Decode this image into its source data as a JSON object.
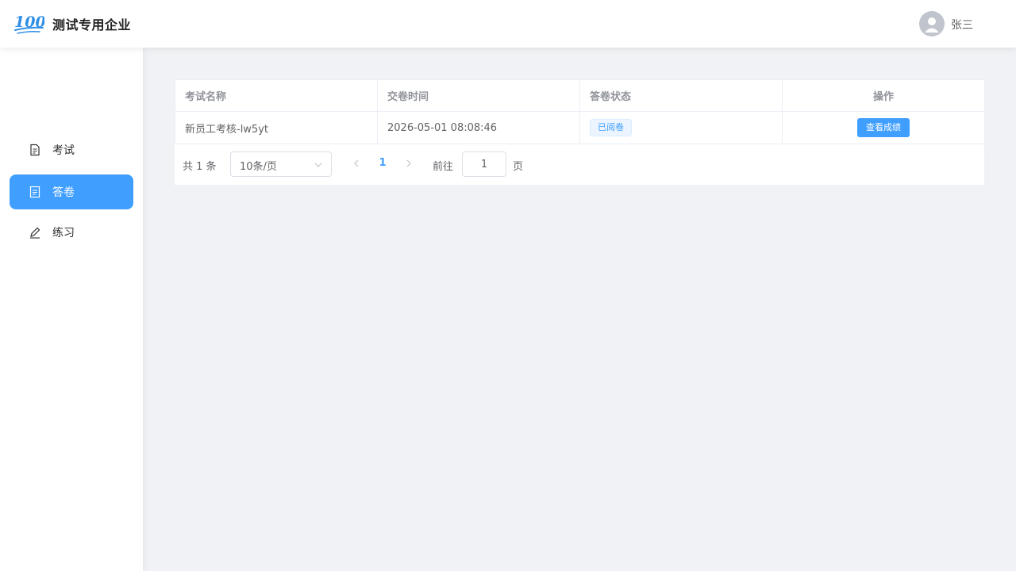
{
  "header": {
    "company_name": "测试专用企业",
    "user_name": "张三",
    "logo_icon": "logo-100-icon",
    "avatar_icon": "user-avatar-icon"
  },
  "sidebar": {
    "items": [
      {
        "label": "考试",
        "icon": "document-icon",
        "active": false
      },
      {
        "label": "答卷",
        "icon": "answer-sheet-icon",
        "active": true
      },
      {
        "label": "练习",
        "icon": "pencil-icon",
        "active": false
      }
    ]
  },
  "table": {
    "headers": [
      "考试名称",
      "交卷时间",
      "答卷状态",
      "操作"
    ],
    "rows": [
      {
        "exam_name": "新员工考核-lw5yt",
        "submit_time": "2026-05-01 08:08:46",
        "status": "已阅卷",
        "action_label": "查看成绩"
      }
    ]
  },
  "pagination": {
    "total_text": "共 1 条",
    "page_size": "10条/页",
    "current_page": "1",
    "goto_label": "前往",
    "goto_value": "1",
    "page_unit": "页"
  },
  "colors": {
    "primary": "#409eff",
    "background": "#f0f2f5",
    "tag_bg": "#ecf5ff"
  }
}
